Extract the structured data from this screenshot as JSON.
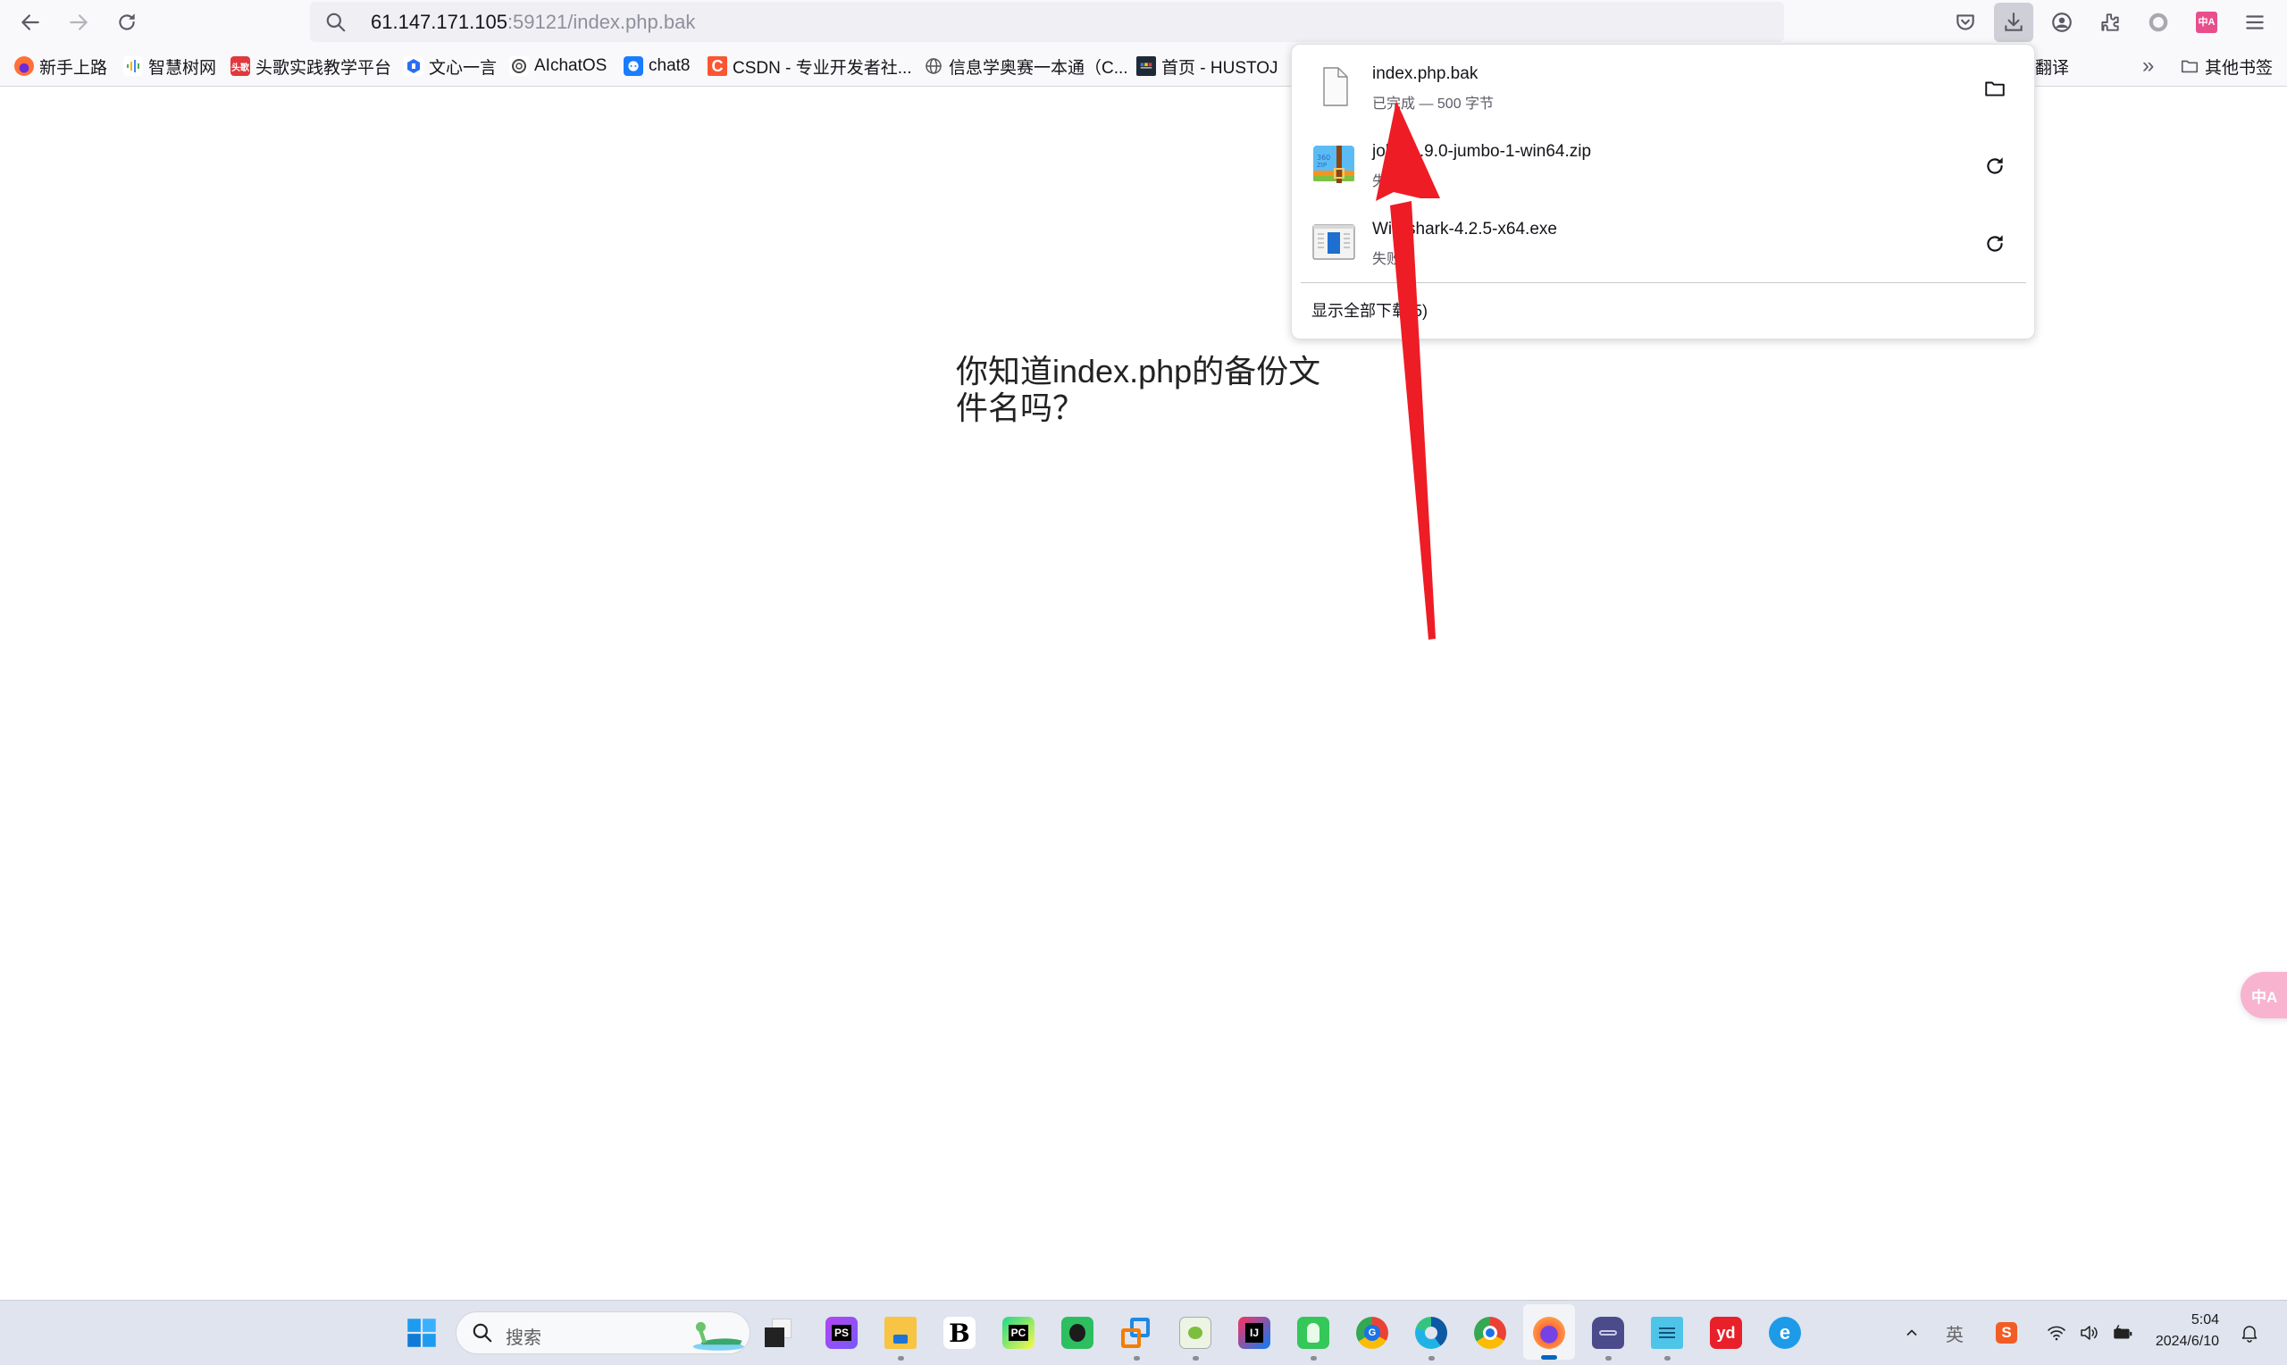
{
  "browser": {
    "url": {
      "host": "61.147.171.105",
      "rest": ":59121/index.php.bak"
    },
    "nav": {
      "back": "back",
      "forward": "forward",
      "reload": "reload"
    },
    "toolbar_icons": [
      "pocket-icon",
      "downloads-icon",
      "account-icon",
      "extensions-icon",
      "circle-extension-icon",
      "translate-icon",
      "menu-icon"
    ],
    "translate_badge": "中A"
  },
  "bookmarks": {
    "items": [
      {
        "label": "新手上路",
        "icon": "firefox-icon",
        "color": "#ff7139"
      },
      {
        "label": "智慧树网",
        "icon": "bars-icon",
        "color": "#4cb050"
      },
      {
        "label": "头歌实践教学平台",
        "icon": "educoder-icon",
        "color": "#e0383e"
      },
      {
        "label": "文心一言",
        "icon": "wenxin-icon",
        "color": "#2a6ef7"
      },
      {
        "label": "AIchatOS",
        "icon": "openai-icon",
        "color": "#555555"
      },
      {
        "label": "chat8",
        "icon": "chat-icon",
        "color": "#1a7cff"
      },
      {
        "label": "CSDN - 专业开发者社...",
        "icon": "csdn-icon",
        "color": "#fc5531"
      },
      {
        "label": "信息学奥赛一本通（C...",
        "icon": "globe-icon",
        "color": "#555555"
      },
      {
        "label": "首页 - HUSTOJ",
        "icon": "hustoj-icon",
        "color": "#1e2a38"
      }
    ],
    "hidden_partial": "翻译",
    "overflow": "»",
    "other": "其他书签"
  },
  "page": {
    "question": "你知道index.php的备份文件名吗？"
  },
  "downloads": {
    "items": [
      {
        "name": "index.php.bak",
        "status": "已完成 — 500 字节",
        "icon": "file-icon",
        "action": "open-folder"
      },
      {
        "name": "john-1.9.0-jumbo-1-win64.zip",
        "status": "失败",
        "icon": "zip-archive-icon",
        "action": "retry"
      },
      {
        "name": "Wireshark-4.2.5-x64.exe",
        "status": "失败",
        "icon": "exe-installer-icon",
        "action": "retry"
      }
    ],
    "show_all": "显示全部下载(5)"
  },
  "taskbar": {
    "search_placeholder": "搜索",
    "apps": [
      {
        "name": "task-view",
        "label": ""
      },
      {
        "name": "phpstorm",
        "label": "PS"
      },
      {
        "name": "file-explorer",
        "label": ""
      },
      {
        "name": "burp-suite",
        "label": "B"
      },
      {
        "name": "pycharm",
        "label": "PC"
      },
      {
        "name": "evernote",
        "label": ""
      },
      {
        "name": "vmware",
        "label": ""
      },
      {
        "name": "notepad-plus-plus",
        "label": ""
      },
      {
        "name": "intellij-idea",
        "label": "IJ"
      },
      {
        "name": "app-green",
        "label": ""
      },
      {
        "name": "chrome-g",
        "label": "G"
      },
      {
        "name": "edge",
        "label": ""
      },
      {
        "name": "chrome",
        "label": ""
      },
      {
        "name": "firefox",
        "label": ""
      },
      {
        "name": "cat-app",
        "label": ""
      },
      {
        "name": "notepad",
        "label": ""
      },
      {
        "name": "youdao",
        "label": "yd"
      },
      {
        "name": "ie-edge-blue",
        "label": "e"
      }
    ],
    "tray": {
      "ime": "英",
      "sogou": "S",
      "time": "5:04",
      "date": "2024/6/10"
    }
  }
}
